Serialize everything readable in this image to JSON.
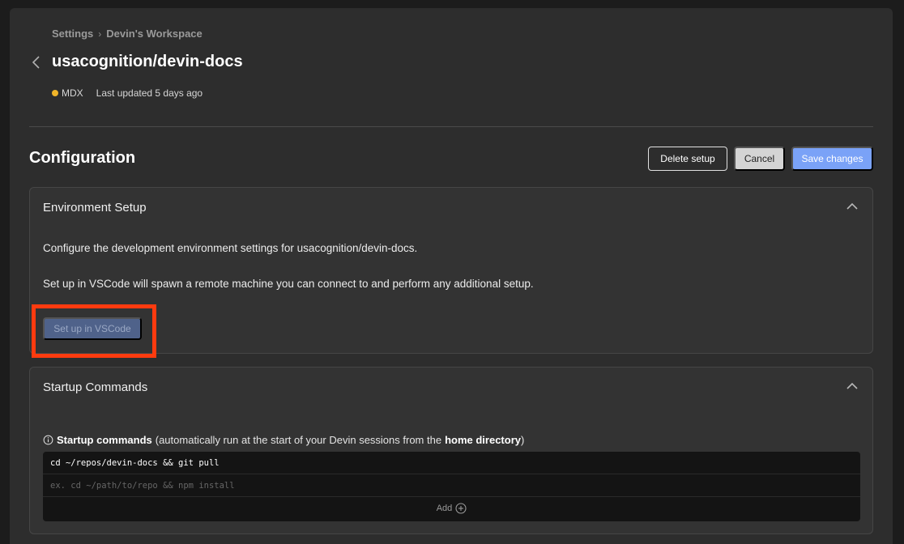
{
  "breadcrumb": {
    "root": "Settings",
    "separator": "›",
    "current": "Devin's Workspace"
  },
  "header": {
    "title": "usacognition/devin-docs",
    "language": "MDX",
    "language_color": "#f0b429",
    "last_updated": "Last updated 5 days ago"
  },
  "configuration": {
    "title": "Configuration",
    "delete_label": "Delete setup",
    "cancel_label": "Cancel",
    "save_label": "Save changes"
  },
  "environment": {
    "title": "Environment Setup",
    "description": "Configure the development environment settings for usacognition/devin-docs.",
    "vscode_note": "Set up in VSCode will spawn a remote machine you can connect to and perform any additional setup.",
    "vscode_button": "Set up in VSCode"
  },
  "startup": {
    "title": "Startup Commands",
    "label_bold": "Startup commands",
    "label_pre": "(automatically run at the start of your Devin sessions from the",
    "label_dir": "home directory",
    "label_post": ")",
    "commands": [
      "cd ~/repos/devin-docs && git pull"
    ],
    "new_command_placeholder": "ex. cd ~/path/to/repo && npm install",
    "add_label": "Add"
  },
  "colors": {
    "accent": "#7aa2f7",
    "highlight": "#ff3b0f"
  }
}
